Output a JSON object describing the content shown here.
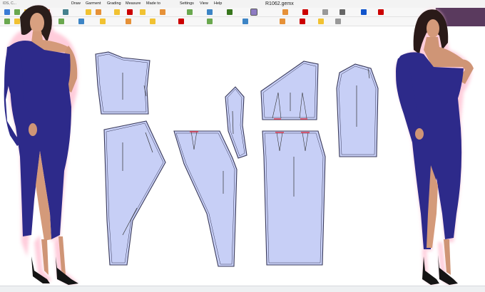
{
  "window": {
    "file_title": "R1062.gemx",
    "app_label": "IDS, C..."
  },
  "menu": {
    "items": [
      "Draw",
      "Garment",
      "Grading",
      "Measure",
      "Made to Measure",
      "Settings",
      "View",
      "Help"
    ]
  },
  "colors": {
    "piece_fill": "#c7cff6",
    "piece_stroke": "#3a3a5a",
    "dart_marker": "#e0445a",
    "model_dress": "#2d2a8a",
    "model_glow": "#ffc8d8",
    "panel_head": "#5a3a5e"
  },
  "icons": {
    "toolbar_row1": [
      "select-icon",
      "zoom-icon",
      "pan-icon",
      "undo-icon",
      "redo-icon",
      "point-icon",
      "line-icon",
      "curve-icon",
      "dart-icon",
      "pleat-icon",
      "notch-icon",
      "grade-icon",
      "measure-icon",
      "print-icon",
      "plot-icon",
      "save-icon"
    ],
    "toolbar_row2": [
      "piece-icon",
      "seam-icon",
      "grainline-icon",
      "mirror-icon",
      "rotate-icon",
      "split-icon",
      "join-icon",
      "cut-icon",
      "move-icon",
      "copy-icon",
      "align-icon",
      "label-icon"
    ]
  }
}
